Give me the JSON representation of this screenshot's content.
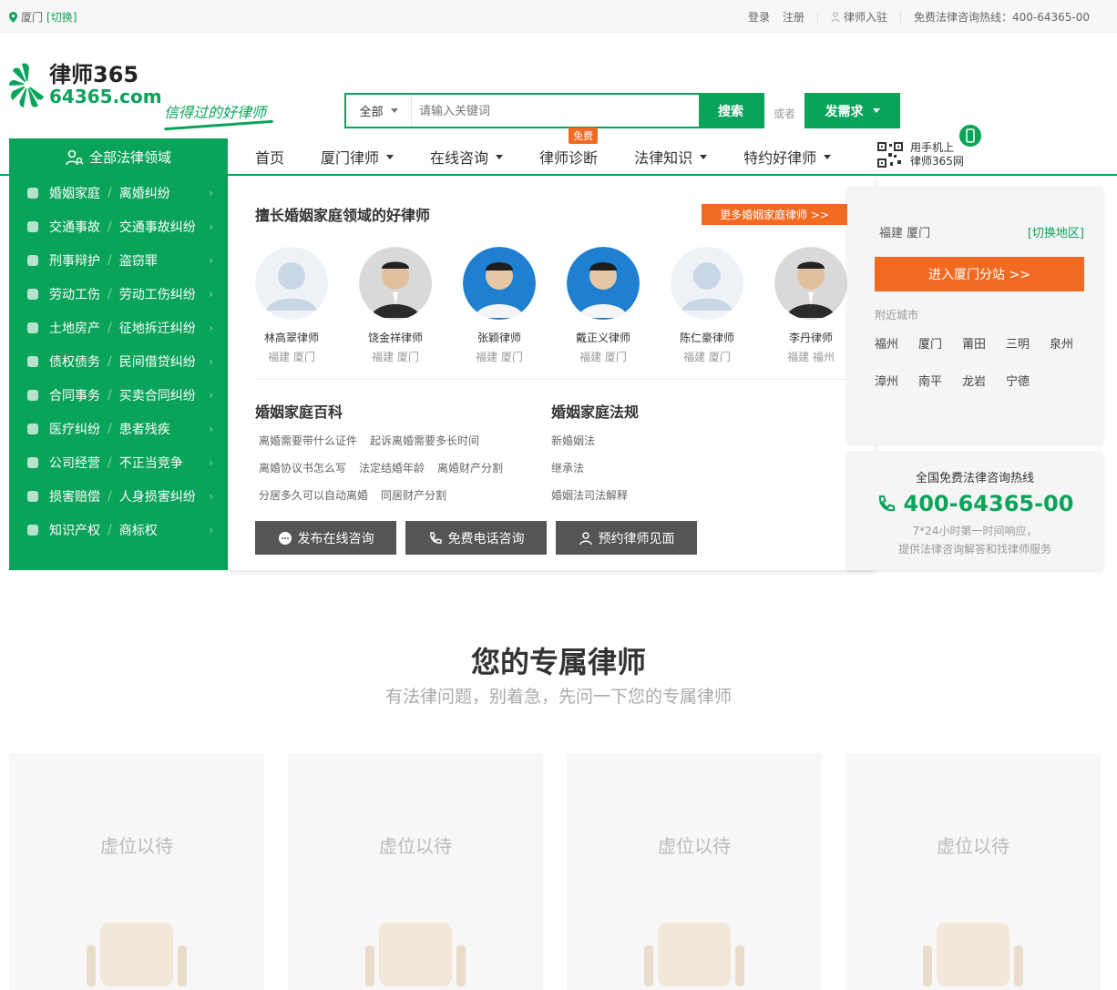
{
  "topbar": {
    "city": "厦门",
    "switch": "[切换]",
    "login": "登录",
    "register": "注册",
    "join": "律师入驻",
    "hotline": "免费法律咨询热线：400-64365-00"
  },
  "logo": {
    "brand": "律师365",
    "domain": "64365.com",
    "slogan": "信得过的好律师"
  },
  "search": {
    "scope": "全部",
    "placeholder": "请输入关键词",
    "button": "搜索",
    "or": "或者",
    "demand": "发需求"
  },
  "nav": {
    "all": "全部法律领域",
    "items": [
      {
        "label": "首页"
      },
      {
        "label": "厦门律师"
      },
      {
        "label": "在线咨询"
      },
      {
        "label": "律师诊断",
        "badge": "免费"
      },
      {
        "label": "法律知识"
      },
      {
        "label": "特约好律师"
      }
    ],
    "mobile1": "用手机上",
    "mobile2": "律师365网"
  },
  "sidebar": [
    {
      "a": "婚姻家庭",
      "b": "离婚纠纷",
      "icon": "heart-icon"
    },
    {
      "a": "交通事故",
      "b": "交通事故纠纷",
      "icon": "car-icon"
    },
    {
      "a": "刑事辩护",
      "b": "盗窃罪",
      "icon": "person-icon"
    },
    {
      "a": "劳动工伤",
      "b": "劳动工伤纠纷",
      "icon": "worker-icon"
    },
    {
      "a": "土地房产",
      "b": "征地拆迁纠纷",
      "icon": "building-icon"
    },
    {
      "a": "债权债务",
      "b": "民间借贷纠纷",
      "icon": "wallet-icon"
    },
    {
      "a": "合同事务",
      "b": "买卖合同纠纷",
      "icon": "document-icon"
    },
    {
      "a": "医疗纠纷",
      "b": "患者残疾",
      "icon": "medical-icon"
    },
    {
      "a": "公司经营",
      "b": "不正当竞争",
      "icon": "company-icon"
    },
    {
      "a": "损害赔偿",
      "b": "人身损害纠纷",
      "icon": "coin-icon"
    },
    {
      "a": "知识产权",
      "b": "商标权",
      "icon": "book-icon"
    }
  ],
  "panel": {
    "title": "擅长婚姻家庭领域的好律师",
    "more": "更多婚姻家庭律师 >>",
    "lawyers": [
      {
        "name": "林高翠律师",
        "place": "福建 厦门",
        "avatar": "placeholder"
      },
      {
        "name": "饶金祥律师",
        "place": "福建 厦门",
        "avatar": "photo"
      },
      {
        "name": "张颖律师",
        "place": "福建 厦门",
        "avatar": "photo-blue"
      },
      {
        "name": "戴正义律师",
        "place": "福建 厦门",
        "avatar": "photo-blue"
      },
      {
        "name": "陈仁豪律师",
        "place": "福建 厦门",
        "avatar": "placeholder"
      },
      {
        "name": "李丹律师",
        "place": "福建 福州",
        "avatar": "photo"
      }
    ],
    "wiki_title": "婚姻家庭百科",
    "wiki": [
      "离婚需要带什么证件",
      "起诉离婚需要多长时间",
      "离婚协议书怎么写",
      "法定结婚年龄",
      "离婚财产分割",
      "分居多久可以自动离婚",
      "同居财产分割"
    ],
    "law_title": "婚姻家庭法规",
    "laws": [
      "新婚姻法",
      "继承法",
      "婚姻法司法解释"
    ],
    "actions": [
      "发布在线咨询",
      "免费电话咨询",
      "预约律师见面"
    ]
  },
  "region": {
    "province": "福建 厦门",
    "switch": "[切换地区]",
    "enter": "进入厦门分站 >>",
    "near": "附近城市",
    "cities": [
      "福州",
      "厦门",
      "莆田",
      "三明",
      "泉州",
      "漳州",
      "南平",
      "龙岩",
      "宁德"
    ]
  },
  "hotline_box": {
    "title": "全国免费法律咨询热线",
    "number": "400-64365-00",
    "desc1": "7*24小时第一时间响应，",
    "desc2": "提供法律咨询解答和找律师服务"
  },
  "section": {
    "title": "您的专属律师",
    "subtitle": "有法律问题，别着急，先问一下您的专属律师",
    "cards": [
      "虚位以待",
      "虚位以待",
      "虚位以待",
      "虚位以待"
    ]
  },
  "colors": {
    "brand": "#0aa35a",
    "accent": "#f06b21"
  }
}
